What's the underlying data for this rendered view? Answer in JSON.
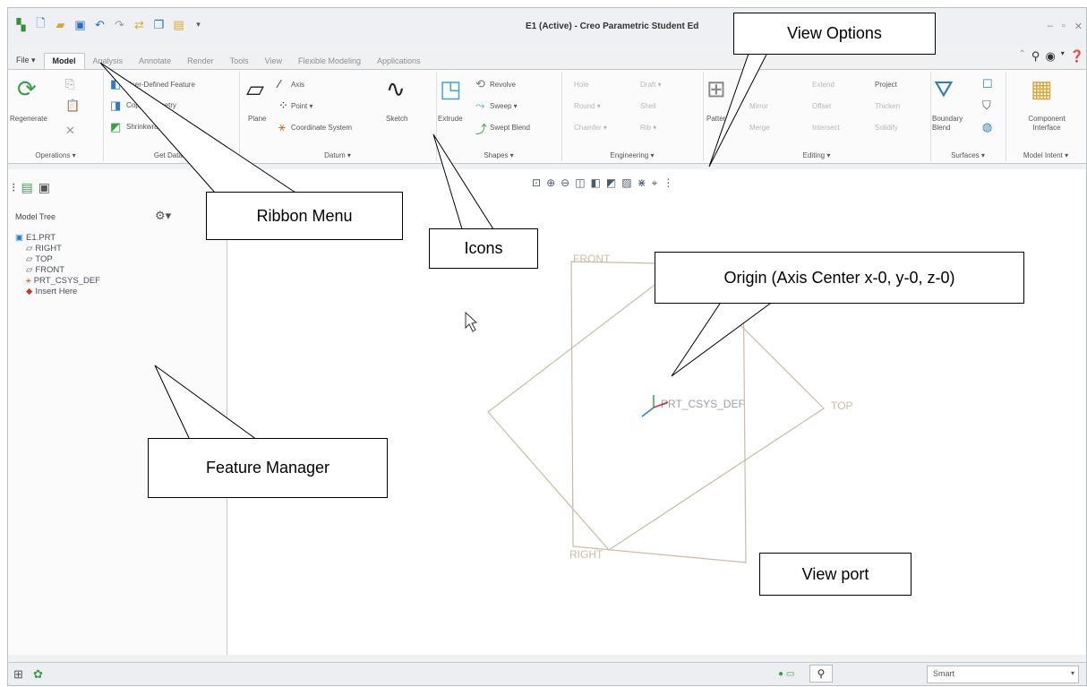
{
  "window": {
    "title": "E1 (Active) - Creo Parametric Student Ed",
    "controls": [
      "–",
      "▫",
      "✕"
    ]
  },
  "ribbon": {
    "tabs": [
      "File ▾",
      "Model",
      "Analysis",
      "Annotate",
      "Render",
      "Tools",
      "View",
      "Flexible Modeling",
      "Applications"
    ],
    "groups": {
      "operations": {
        "label": "Operations ▾",
        "regenerate": "Regenerate"
      },
      "get_data": {
        "label": "Get Data ▾",
        "items": [
          "User-Defined Feature",
          "Copy Geometry",
          "Shrinkwrap"
        ]
      },
      "datum": {
        "label": "Datum ▾",
        "plane": "Plane",
        "axis": "Axis",
        "point": "Point ▾",
        "csys": "Coordinate System",
        "sketch": "Sketch"
      },
      "shapes": {
        "label": "Shapes ▾",
        "extrude": "Extrude",
        "revolve": "Revolve",
        "sweep": "Sweep ▾",
        "swept_blend": "Swept Blend"
      },
      "engineering": {
        "label": "Engineering ▾",
        "items": [
          "Hole",
          "Round ▾",
          "Chamfer ▾",
          "Draft ▾",
          "Shell",
          "Rib ▾"
        ]
      },
      "editing": {
        "label": "Editing ▾",
        "pattern": "Pattern",
        "items": [
          "Mirror",
          "Merge",
          "Extend",
          "Offset",
          "Intersect",
          "Project",
          "Thicken",
          "Solidify"
        ]
      },
      "surfaces": {
        "label": "Surfaces ▾",
        "boundary": "Boundary Blend"
      },
      "model_intent": {
        "label": "Model Intent ▾",
        "component": "Component Interface"
      }
    }
  },
  "model_tree": {
    "header": "Model Tree",
    "items": [
      {
        "icon": "part-icon",
        "label": "E1.PRT"
      },
      {
        "icon": "datum-plane-icon",
        "label": "RIGHT"
      },
      {
        "icon": "datum-plane-icon",
        "label": "TOP"
      },
      {
        "icon": "datum-plane-icon",
        "label": "FRONT"
      },
      {
        "icon": "csys-icon",
        "label": "PRT_CSYS_DEF"
      },
      {
        "icon": "insert-here-icon",
        "label": "Insert Here"
      }
    ]
  },
  "viewport": {
    "datums": {
      "front": "FRONT",
      "top": "TOP",
      "right": "RIGHT",
      "csys": "PRT_CSYS_DEF"
    }
  },
  "status": {
    "filter": "Smart"
  },
  "annotations": {
    "ribbon_menu": "Ribbon Menu",
    "icons": "Icons",
    "view_options": "View Options",
    "origin": "Origin (Axis Center x-0, y-0, z-0)",
    "feature_manager": "Feature Manager",
    "view_port": "View port"
  },
  "colors": {
    "datum": "#c9bca3",
    "accent": "#2e7cc4",
    "callout_border": "#000000"
  }
}
